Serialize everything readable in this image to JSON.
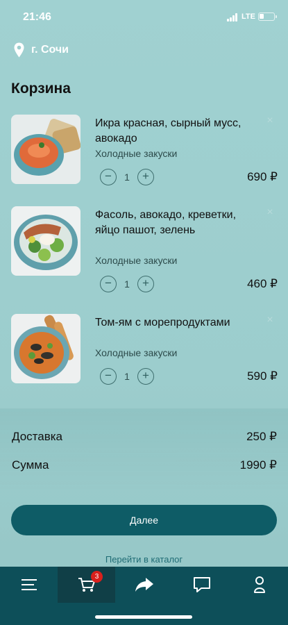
{
  "status_bar": {
    "time": "21:46",
    "network": "LTE"
  },
  "location": {
    "city": "г. Сочи"
  },
  "page": {
    "title": "Корзина"
  },
  "cart": {
    "items": [
      {
        "name": "Икра красная, сырный мусс, авокадо",
        "category": "Холодные закуски",
        "quantity": "1",
        "price": "690 ₽",
        "remove_icon": "close-icon"
      },
      {
        "name": "Фасоль, авокадо, креветки, яйцо пашот, зелень",
        "category": "Холодные закуски",
        "quantity": "1",
        "price": "460 ₽",
        "remove_icon": "close-icon"
      },
      {
        "name": "Том-ям с морепродуктами",
        "category": "Холодные закуски",
        "quantity": "1",
        "price": "590 ₽",
        "remove_icon": "close-icon"
      }
    ],
    "minus_symbol": "−",
    "plus_symbol": "+"
  },
  "totals": {
    "delivery_label": "Доставка",
    "delivery_value": "250 ₽",
    "sum_label": "Сумма",
    "sum_value": "1990 ₽"
  },
  "actions": {
    "next_label": "Далее",
    "catalog_link": "Перейти в каталог"
  },
  "tab_bar": {
    "items": [
      {
        "icon": "menu-icon"
      },
      {
        "icon": "cart-icon",
        "badge": "3",
        "active": true
      },
      {
        "icon": "share-icon"
      },
      {
        "icon": "chat-icon"
      },
      {
        "icon": "profile-icon"
      }
    ]
  },
  "colors": {
    "background": "#9dcfcf",
    "accent": "#0e5c66",
    "tab_bar": "#0d4f59",
    "badge": "#d9201c"
  }
}
